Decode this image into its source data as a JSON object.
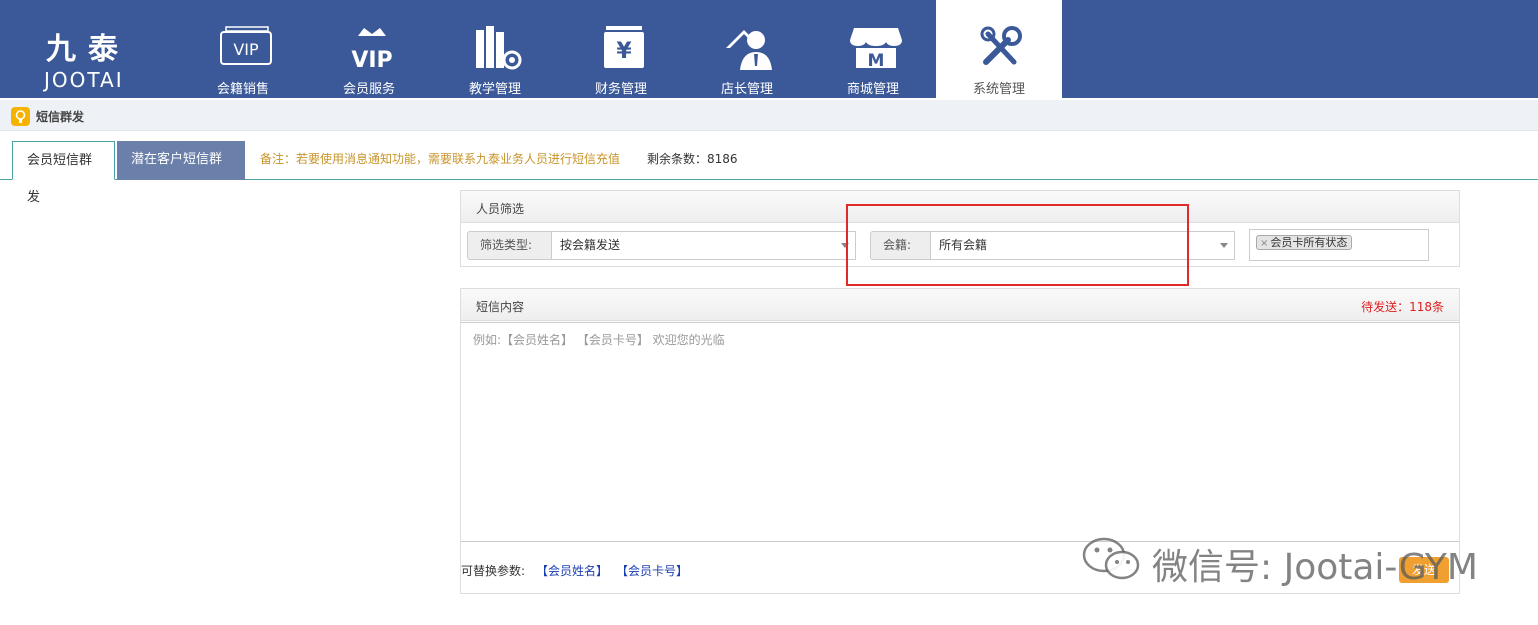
{
  "brand": {
    "cn": "九泰",
    "en": "JOOTAI"
  },
  "nav": {
    "items": [
      {
        "label": "会籍销售",
        "icon": "vip-card-icon"
      },
      {
        "label": "会员服务",
        "icon": "vip-crown-icon"
      },
      {
        "label": "教学管理",
        "icon": "books-gear-icon"
      },
      {
        "label": "财务管理",
        "icon": "yen-box-icon"
      },
      {
        "label": "店长管理",
        "icon": "manager-house-icon"
      },
      {
        "label": "商城管理",
        "icon": "store-icon"
      },
      {
        "label": "系统管理",
        "icon": "tools-icon"
      }
    ],
    "active_index": 6
  },
  "breadcrumb": {
    "title": "短信群发"
  },
  "tabs": [
    {
      "label": "会员短信群发",
      "active": true
    },
    {
      "label": "潜在客户短信群发",
      "active": false
    }
  ],
  "note": "备注：若要使用消息通知功能，需要联系九泰业务人员进行短信充值",
  "remaining": "剩余条数：8186",
  "filter": {
    "title": "人员筛选",
    "type_label": "筛选类型:",
    "type_value": "按会籍发送",
    "membership_label": "会籍:",
    "membership_value": "所有会籍",
    "status_tag": "会员卡所有状态"
  },
  "sms": {
    "title": "短信内容",
    "pending": "待发送：118条",
    "placeholder": "例如:【会员姓名】 【会员卡号】 欢迎您的光临",
    "params_label": "可替换参数:",
    "params": [
      "【会员姓名】",
      "【会员卡号】"
    ],
    "send_label": "发送"
  },
  "watermark": "微信号: Jootai-GYM",
  "colors": {
    "topbar": "#3b5998",
    "accent": "#f0a030",
    "highlight": "#e02a2a",
    "pending": "#e02020"
  }
}
